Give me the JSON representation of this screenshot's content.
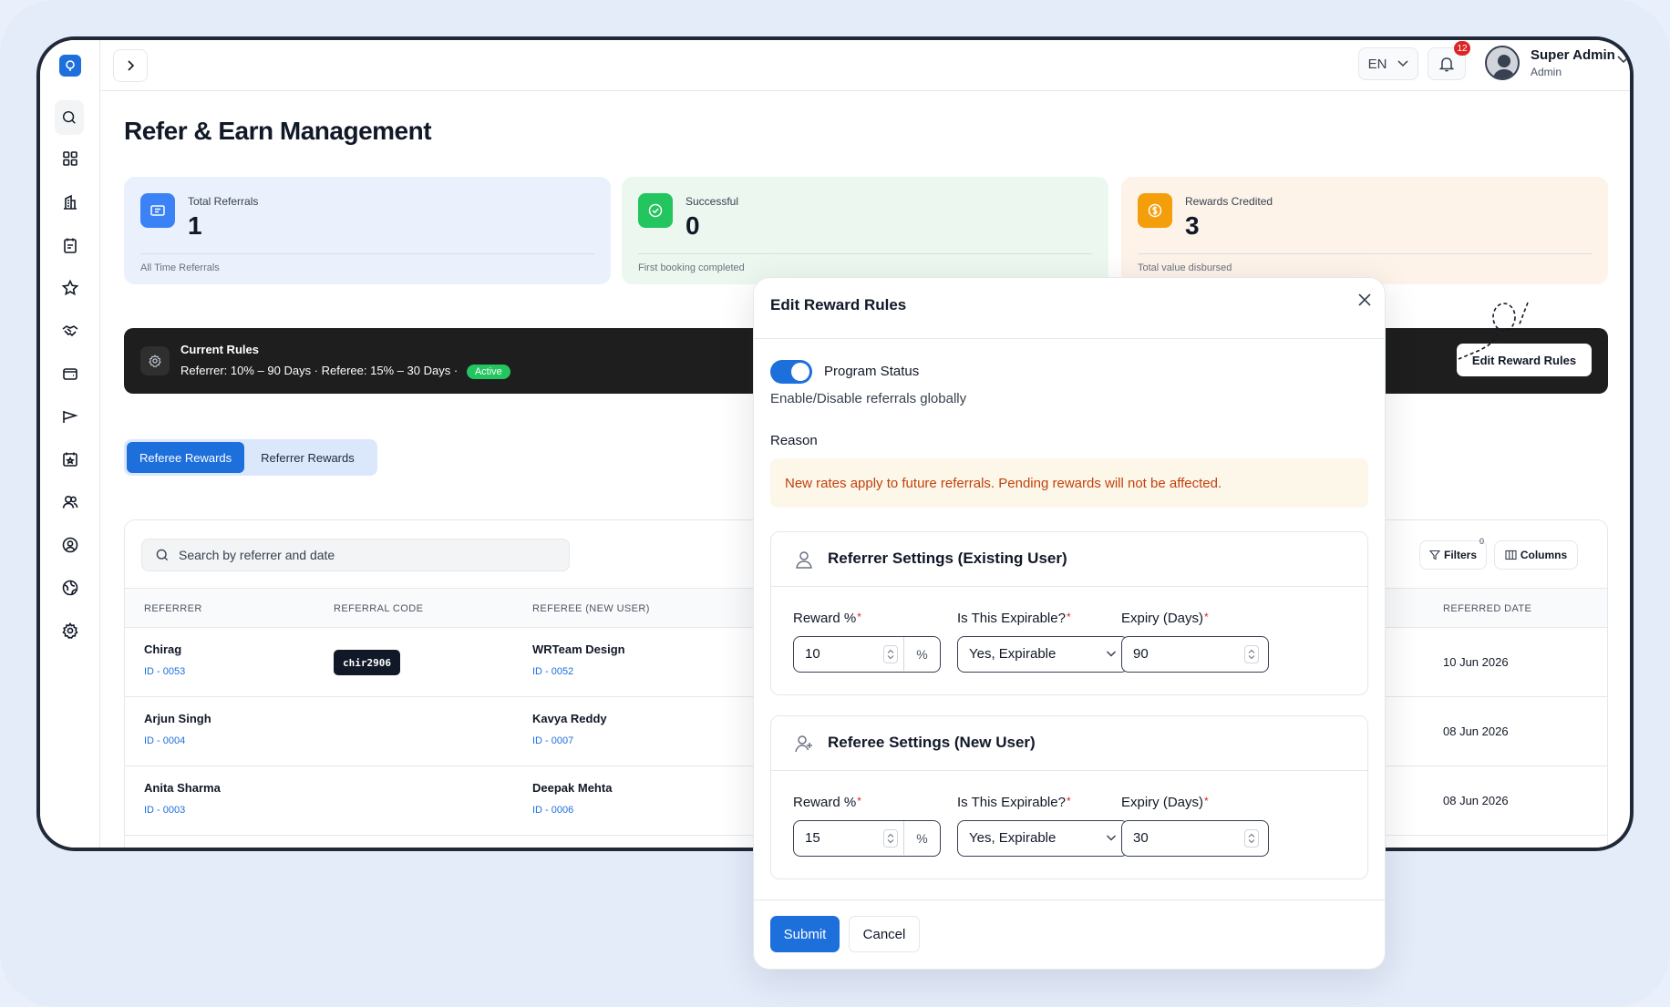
{
  "topbar": {
    "language": "EN",
    "notification_count": "12",
    "user_name": "Super Admin",
    "user_role": "Admin"
  },
  "page": {
    "title": "Refer & Earn Management"
  },
  "stats": [
    {
      "label": "Total Referrals",
      "value": "1",
      "footnote": "All Time Referrals",
      "icon": "ticket-icon",
      "bg": "#eaf1fd",
      "icon_bg": "#3b82f6"
    },
    {
      "label": "Successful",
      "value": "0",
      "footnote": "First booking completed",
      "icon": "check-circle-icon",
      "bg": "#ecf8ef",
      "icon_bg": "#22c55e"
    },
    {
      "label": "Rewards Credited",
      "value": "3",
      "footnote": "Total value disbursed",
      "icon": "dollar-coin-icon",
      "bg": "#fdf3e9",
      "icon_bg": "#f59e0b"
    }
  ],
  "rules": {
    "title": "Current Rules",
    "text": "Referrer: 10% – 90 Days · Referee: 15% – 30 Days ·",
    "status": "Active",
    "edit_button": "Edit Reward Rules"
  },
  "tabs": [
    {
      "label": "Referee Rewards",
      "active": true
    },
    {
      "label": "Referrer Rewards",
      "active": false
    }
  ],
  "table": {
    "search_placeholder": "Search by referrer and date",
    "filters_label": "Filters",
    "filters_count": "0",
    "columns_label": "Columns",
    "headers": {
      "referrer": "REFERRER",
      "code": "REFERRAL CODE",
      "referee": "REFEREE (NEW USER)",
      "date": "REFERRED DATE"
    },
    "rows": [
      {
        "referrer": "Chirag",
        "referrer_id": "ID - 0053",
        "code": "chir2906",
        "referee": "WRTeam Design",
        "referee_id": "ID - 0052",
        "date": "10 Jun 2026"
      },
      {
        "referrer": "Arjun Singh",
        "referrer_id": "ID - 0004",
        "code": "",
        "referee": "Kavya Reddy",
        "referee_id": "ID - 0007",
        "date": "08 Jun 2026"
      },
      {
        "referrer": "Anita Sharma",
        "referrer_id": "ID - 0003",
        "code": "",
        "referee": "Deepak Mehta",
        "referee_id": "ID - 0006",
        "date": "08 Jun 2026"
      }
    ]
  },
  "modal": {
    "title": "Edit Reward Rules",
    "program_status_label": "Program Status",
    "program_status_on": true,
    "program_status_desc": "Enable/Disable referrals globally",
    "reason_label": "Reason",
    "reason_text": "New rates apply to future referrals. Pending rewards will not be affected.",
    "referrer": {
      "title": "Referrer Settings (Existing User)",
      "reward_label": "Reward %",
      "reward_value": "10",
      "reward_unit": "%",
      "expirable_label": "Is This Expirable?",
      "expirable_value": "Yes, Expirable",
      "expiry_label": "Expiry (Days)",
      "expiry_value": "90"
    },
    "referee": {
      "title": "Referee Settings (New User)",
      "reward_label": "Reward %",
      "reward_value": "15",
      "reward_unit": "%",
      "expirable_label": "Is This Expirable?",
      "expirable_value": "Yes, Expirable",
      "expiry_label": "Expiry (Days)",
      "expiry_value": "30"
    },
    "submit_label": "Submit",
    "cancel_label": "Cancel"
  },
  "colors": {
    "primary": "#1d6fdc",
    "dark_bar": "#1e1e1e",
    "active_badge": "#22c55e",
    "reason_text": "#c2410c",
    "required": "#dc2626"
  }
}
